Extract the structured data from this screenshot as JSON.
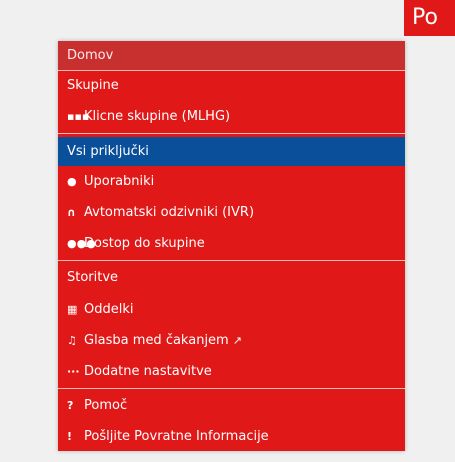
{
  "top_tab": {
    "label": "Po"
  },
  "menu": {
    "home": "Domov",
    "groups_header": "Skupine",
    "items_groups": [
      {
        "label": "Klicne skupine (MLHG)",
        "icon": "hunt-group-icon",
        "glyph": "▪▪▪"
      }
    ],
    "selected_item": "Vsi priključki",
    "items_extensions": [
      {
        "label": "Uporabniki",
        "icon": "user-icon",
        "glyph": "●"
      },
      {
        "label": "Avtomatski odzivniki (IVR)",
        "icon": "headset-icon",
        "glyph": "∩"
      },
      {
        "label": "Dostop do skupine",
        "icon": "group-icon",
        "glyph": "●●●"
      }
    ],
    "services_header": "Storitve",
    "items_services": [
      {
        "label": "Oddelki",
        "icon": "department-icon",
        "glyph": "▦"
      },
      {
        "label": "Glasba med čakanjem",
        "icon": "music-icon",
        "glyph": "♫",
        "external_glyph": "↗"
      },
      {
        "label": "Dodatne nastavitve",
        "icon": "more-icon",
        "glyph": "···"
      }
    ],
    "items_help": [
      {
        "label": "Pomoč",
        "icon": "question-icon",
        "glyph": "?"
      },
      {
        "label": "Pošljite Povratne Informacije",
        "icon": "exclamation-icon",
        "glyph": "!"
      }
    ]
  },
  "colors": {
    "menu_bg": "#e01818",
    "selected_bg": "#0a4f9a",
    "header_bg": "#c82f2f"
  }
}
